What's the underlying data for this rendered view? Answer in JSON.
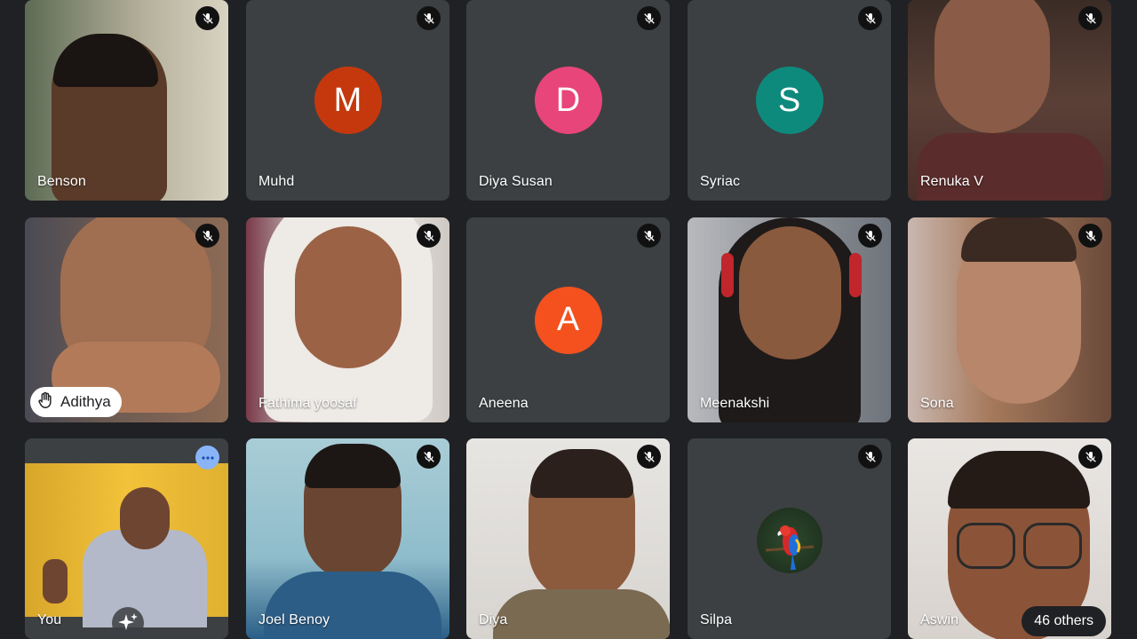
{
  "participants": [
    {
      "name": "Benson",
      "muted": true,
      "type": "video"
    },
    {
      "name": "Muhd",
      "muted": true,
      "type": "avatar",
      "initial": "M",
      "color": "#c5380d"
    },
    {
      "name": "Diya Susan",
      "muted": true,
      "type": "avatar",
      "initial": "D",
      "color": "#e8457a"
    },
    {
      "name": "Syriac",
      "muted": true,
      "type": "avatar",
      "initial": "S",
      "color": "#0e8a7d"
    },
    {
      "name": "Renuka V",
      "muted": true,
      "type": "video"
    },
    {
      "name": "Adithya",
      "muted": true,
      "type": "video",
      "hand_raised": true
    },
    {
      "name": "Fathima yoosaf",
      "muted": true,
      "type": "video"
    },
    {
      "name": "Aneena",
      "muted": true,
      "type": "avatar",
      "initial": "A",
      "color": "#f4511e"
    },
    {
      "name": "Meenakshi",
      "muted": true,
      "type": "video"
    },
    {
      "name": "Sona",
      "muted": true,
      "type": "video"
    },
    {
      "name": "You",
      "muted": false,
      "type": "video",
      "self": true
    },
    {
      "name": "Joel Benoy",
      "muted": true,
      "type": "video"
    },
    {
      "name": "Diya",
      "muted": true,
      "type": "video"
    },
    {
      "name": "Silpa",
      "muted": true,
      "type": "profile-picture"
    },
    {
      "name": "Aswin",
      "muted": true,
      "type": "video"
    }
  ],
  "others_label": "46 others",
  "icons": {
    "mute": "mic-off-icon",
    "hand": "raised-hand-icon",
    "more": "more-options-icon",
    "effects": "sparkle-icon"
  },
  "colors": {
    "background": "#202124",
    "tile": "#3c4043",
    "accent": "#8ab4f8"
  }
}
